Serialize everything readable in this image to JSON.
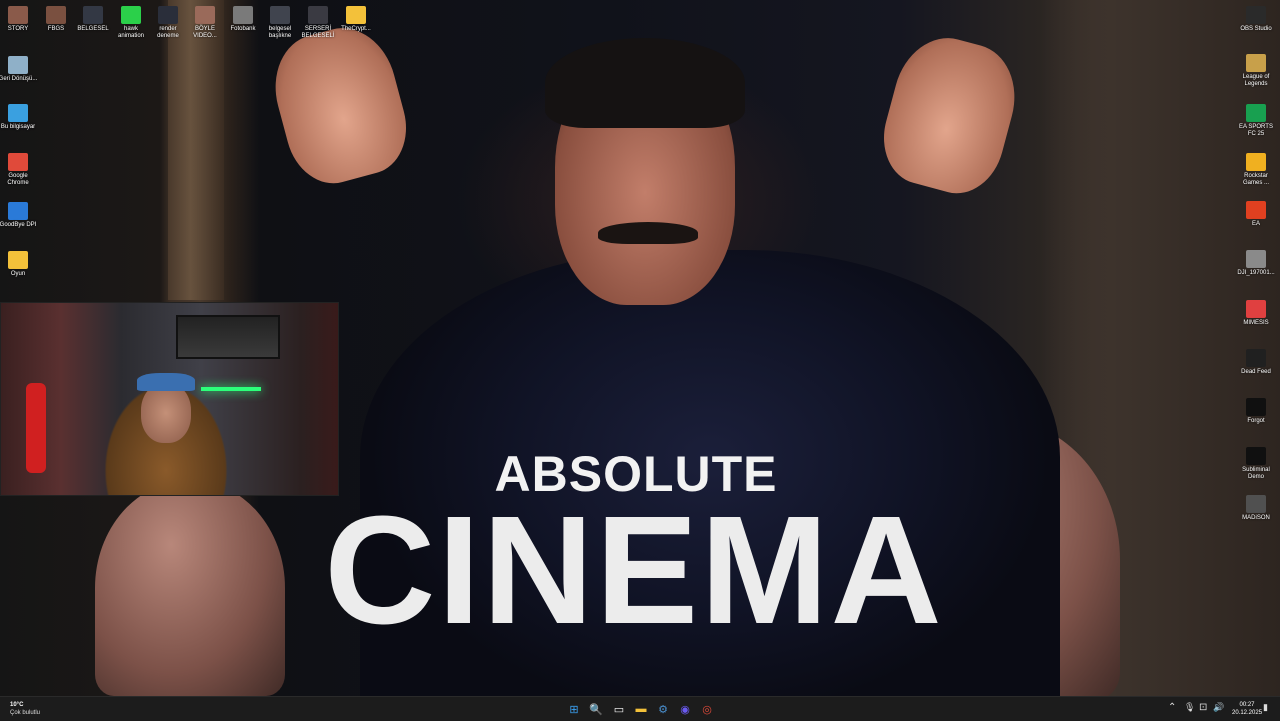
{
  "wallpaper": {
    "title_line1": "ABSOLUTE",
    "title_line2": "CINEMA"
  },
  "desktop_top_icons": [
    {
      "label": "STORY",
      "icon": "person-thumbnail-icon",
      "color": "#8a5a4a"
    },
    {
      "label": "FBGS",
      "icon": "person-thumbnail-icon",
      "color": "#7a5040"
    },
    {
      "label": "BELGESEL",
      "icon": "video-thumbnail-icon",
      "color": "#333844"
    },
    {
      "label": "hawk animation",
      "icon": "green-clip-icon",
      "color": "#2bd04a"
    },
    {
      "label": "render deneme",
      "icon": "video-thumbnail-icon",
      "color": "#2a2e3a"
    },
    {
      "label": "BÖYLE VIDEO...",
      "icon": "person-thumbnail-icon",
      "color": "#9a6a5a"
    },
    {
      "label": "Fotobank",
      "icon": "person-thumbnail-icon",
      "color": "#7a7a7a"
    },
    {
      "label": "belgesel başlıkne",
      "icon": "video-thumbnail-icon",
      "color": "#40444e"
    },
    {
      "label": "SERSERİ BELGESELİ",
      "icon": "video-thumbnail-icon",
      "color": "#3a3a42"
    },
    {
      "label": "TheCrypt...",
      "icon": "folder-icon",
      "color": "#f3c13a"
    }
  ],
  "desktop_left_icons": [
    {
      "label": "Geri Dönüşü...",
      "icon": "recycle-bin-icon",
      "color": "#8fb0c8"
    },
    {
      "label": "Bu bilgisayar",
      "icon": "computer-icon",
      "color": "#3aa0e0"
    },
    {
      "label": "Google Chrome",
      "icon": "chrome-icon",
      "color": "#e04a3a"
    },
    {
      "label": "GoodBye DPI",
      "icon": "internet-explorer-icon",
      "color": "#2a7ad8"
    },
    {
      "label": "Oyun",
      "icon": "folder-icon",
      "color": "#f3c13a"
    }
  ],
  "desktop_right_icons": [
    {
      "label": "OBS Studio",
      "icon": "obs-icon",
      "color": "#2a2a2a"
    },
    {
      "label": "League of Legends",
      "icon": "league-icon",
      "color": "#c8a04a"
    },
    {
      "label": "EA SPORTS FC 25",
      "icon": "fc25-icon",
      "color": "#18a050"
    },
    {
      "label": "Rockstar Games ...",
      "icon": "rockstar-icon",
      "color": "#f0b020"
    },
    {
      "label": "EA",
      "icon": "ea-icon",
      "color": "#e04020"
    },
    {
      "label": "DJI_197001...",
      "icon": "image-thumbnail-icon",
      "color": "#8a8a8a"
    },
    {
      "label": "MIMESIS",
      "icon": "mimesis-icon",
      "color": "#e04040"
    },
    {
      "label": "Dead Feed",
      "icon": "dead-feed-icon",
      "color": "#202020"
    },
    {
      "label": "Forgot",
      "icon": "forgot-icon",
      "color": "#101010"
    },
    {
      "label": "Subliminal Demo",
      "icon": "subliminal-icon",
      "color": "#101010"
    },
    {
      "label": "MADiSON",
      "icon": "madison-icon",
      "color": "#505050"
    }
  ],
  "taskbar": {
    "weather_temp": "10°C",
    "weather_desc": "Çok bulutlu",
    "pinned": [
      {
        "name": "start-button",
        "glyph": "⊞",
        "color": "#3a9ff0"
      },
      {
        "name": "search-button",
        "glyph": "🔍",
        "color": "#ffffff"
      },
      {
        "name": "task-view-button",
        "glyph": "▭",
        "color": "#ffffff"
      },
      {
        "name": "file-explorer-button",
        "glyph": "▬",
        "color": "#f3c13a"
      },
      {
        "name": "steam-button",
        "glyph": "⚙",
        "color": "#4a90d0"
      },
      {
        "name": "discord-button",
        "glyph": "◉",
        "color": "#6a5af0"
      },
      {
        "name": "chrome-button",
        "glyph": "◎",
        "color": "#e04a3a"
      }
    ],
    "tray": {
      "chevron": "⌃",
      "mic": "🎙",
      "network": "⊡",
      "volume": "🔊"
    },
    "time": "00:27",
    "date": "20.12.2025"
  }
}
